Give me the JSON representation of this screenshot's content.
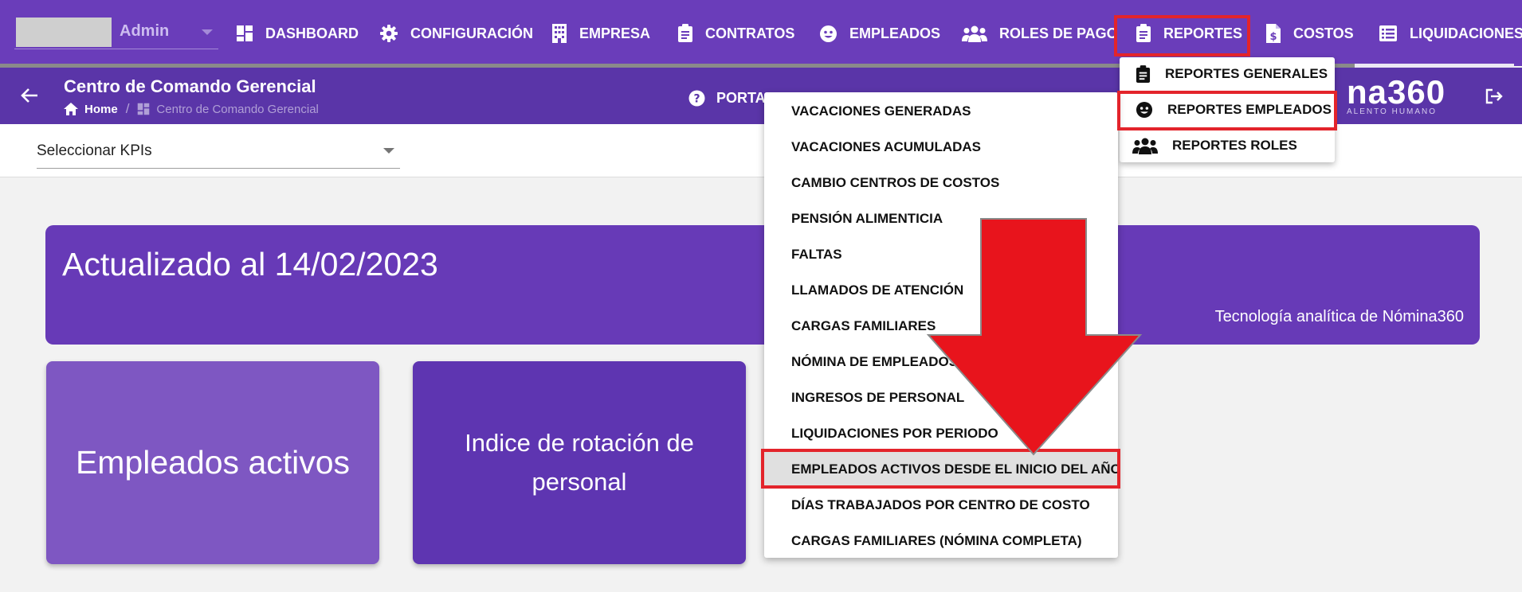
{
  "user": {
    "name": "Admin"
  },
  "nav": {
    "items": [
      {
        "label": "DASHBOARD",
        "icon": "dashboard-icon"
      },
      {
        "label": "CONFIGURACIÓN",
        "icon": "gear-icon"
      },
      {
        "label": "EMPRESA",
        "icon": "building-icon"
      },
      {
        "label": "CONTRATOS",
        "icon": "clipboard-icon"
      },
      {
        "label": "EMPLEADOS",
        "icon": "face-icon"
      },
      {
        "label": "ROLES DE PAGO",
        "icon": "people-icon"
      },
      {
        "label": "REPORTES",
        "icon": "clipboard-icon"
      },
      {
        "label": "COSTOS",
        "icon": "file-dollar-icon"
      },
      {
        "label": "LIQUIDACIONES",
        "icon": "list-icon"
      }
    ]
  },
  "header": {
    "title": "Centro de Comando Gerencial",
    "breadcrumb": {
      "home": "Home",
      "current": "Centro de Comando Gerencial"
    },
    "portal_label": "PORTA",
    "brand": "na360",
    "brand_sub": "ALENTO HUMANO"
  },
  "kpi_selector": {
    "label": "Seleccionar KPIs"
  },
  "banner": {
    "title": "Actualizado al 14/02/2023",
    "subtitle": "Tecnología analítica de Nómina360"
  },
  "cards": [
    {
      "label": "Empleados activos"
    },
    {
      "label": "Indice de rotación de personal"
    }
  ],
  "reportes_menu": {
    "items": [
      {
        "label": "REPORTES GENERALES",
        "icon": "clipboard-icon"
      },
      {
        "label": "REPORTES EMPLEADOS",
        "icon": "face-icon"
      },
      {
        "label": "REPORTES ROLES",
        "icon": "people-icon"
      }
    ]
  },
  "reportes_empleados": {
    "items": [
      "VACACIONES GENERADAS",
      "VACACIONES ACUMULADAS",
      "CAMBIO CENTROS DE COSTOS",
      "PENSIÓN ALIMENTICIA",
      "FALTAS",
      "LLAMADOS DE ATENCIÓN",
      "CARGAS FAMILIARES",
      "NÓMINA DE EMPLEADOS",
      "INGRESOS DE PERSONAL",
      "LIQUIDACIONES POR PERIODO",
      "EMPLEADOS ACTIVOS DESDE EL INICIO DEL AÑO",
      "DÍAS TRABAJADOS POR CENTRO DE COSTO",
      "CARGAS FAMILIARES (NÓMINA COMPLETA)"
    ],
    "highlighted": "EMPLEADOS ACTIVOS DESDE EL INICIO DEL AÑO"
  },
  "colors": {
    "nav_bg": "#6a3dba",
    "subheader_bg": "#5a35a8",
    "banner_bg": "#673ab7",
    "card1_bg": "#7e57c2",
    "card2_bg": "#5e35b1",
    "highlight_red": "#e3242b"
  }
}
